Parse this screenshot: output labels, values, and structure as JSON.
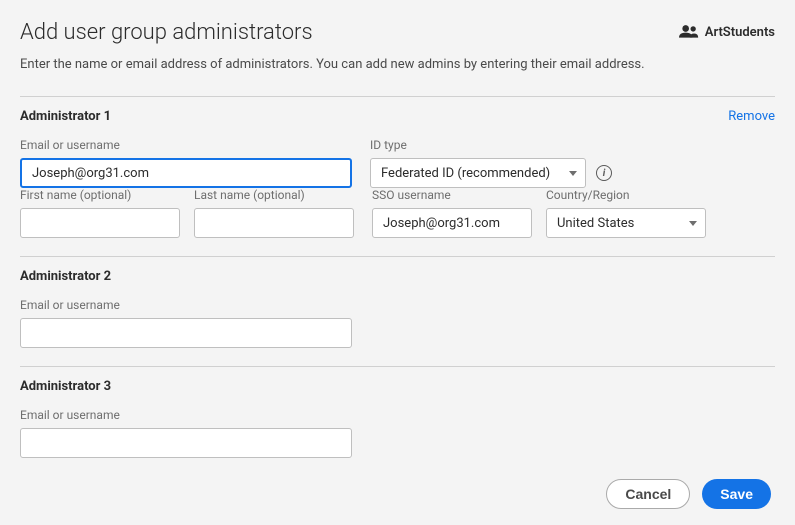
{
  "header": {
    "title": "Add user group administrators",
    "group_name": "ArtStudents",
    "subtitle": "Enter the name or email address of administrators. You can add new admins by entering their email address."
  },
  "labels": {
    "email_or_username": "Email or username",
    "id_type": "ID type",
    "first_name": "First name (optional)",
    "last_name": "Last name (optional)",
    "sso_username": "SSO username",
    "country_region": "Country/Region",
    "remove": "Remove"
  },
  "admins": [
    {
      "title": "Administrator 1",
      "email": "Joseph@org31.com",
      "id_type": "Federated ID (recommended)",
      "first_name": "",
      "last_name": "",
      "sso_username": "Joseph@org31.com",
      "country": "United States",
      "expanded": true,
      "focused": true,
      "removable": true
    },
    {
      "title": "Administrator 2",
      "email": "",
      "expanded": false
    },
    {
      "title": "Administrator 3",
      "email": "",
      "expanded": false
    }
  ],
  "buttons": {
    "cancel": "Cancel",
    "save": "Save"
  }
}
